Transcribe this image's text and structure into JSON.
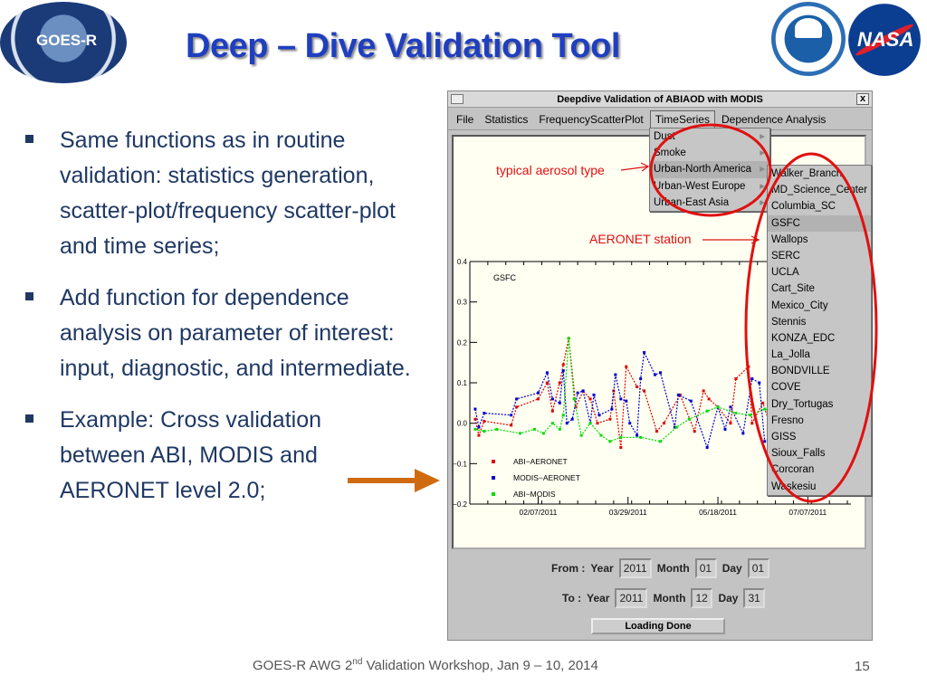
{
  "title": "Deep – Dive Validation Tool",
  "logos": {
    "left": "GOES-R",
    "right1": "NOAA",
    "right2": "NASA"
  },
  "bullets": [
    "Same functions as in routine validation: statistics generation, scatter-plot/frequency scatter-plot and time series;",
    "Add function for dependence analysis on parameter of interest: input, diagnostic, and intermediate.",
    "Example: Cross validation between ABI, MODIS and AERONET level 2.0;"
  ],
  "window": {
    "title": "Deepdive Validation of ABIAOD with MODIS",
    "close": "x",
    "menubar": [
      "File",
      "Statistics",
      "FrequencyScatterPlot",
      "TimeSeries",
      "Dependence Analysis"
    ],
    "open_menu": "TimeSeries",
    "aerosol_menu": [
      "Dust",
      "Smoke",
      "Urban-North America",
      "Urban-West Europe",
      "Urban-East Asia"
    ],
    "aerosol_selected": "Urban-North America",
    "station_menu": [
      "Walker_Branch",
      "MD_Science_Center",
      "Columbia_SC",
      "GSFC",
      "Wallops",
      "SERC",
      "UCLA",
      "Cart_Site",
      "Mexico_City",
      "Stennis",
      "KONZA_EDC",
      "La_Jolla",
      "BONDVILLE",
      "COVE",
      "Dry_Tortugas",
      "Fresno",
      "GISS",
      "Sioux_Falls",
      "Corcoran",
      "Waskesiu"
    ],
    "station_selected": "GSFC",
    "from": {
      "label": "From :",
      "year_label": "Year",
      "year": "2011",
      "month_label": "Month",
      "month": "01",
      "day_label": "Day",
      "day": "01"
    },
    "to": {
      "label": "To :",
      "year_label": "Year",
      "year": "2011",
      "month_label": "Month",
      "month": "12",
      "day_label": "Day",
      "day": "31"
    },
    "button": "Loading Done"
  },
  "annotations": {
    "aerosol": "typical aerosol type",
    "station": "AERONET station",
    "color": "#e01010"
  },
  "footer": {
    "text": "GOES-R AWG 2",
    "sup": "nd",
    "rest": " Validation Workshop, Jan 9 – 10, 2014",
    "page": "15"
  },
  "chart_data": {
    "type": "line",
    "title": "GSFC",
    "ylim": [
      -0.2,
      0.4
    ],
    "yticks": [
      "0.4",
      "0.3",
      "0.2",
      "0.1",
      "0.0",
      "−0.1",
      "−0.2"
    ],
    "xticks": [
      "02/07/2011",
      "03/29/2011",
      "05/18/2011",
      "07/07/2011"
    ],
    "xlim": [
      "2010-12-31",
      "2011-07-31"
    ],
    "legend": "bottom-left",
    "series": [
      {
        "name": "ABI−AERONET",
        "color": "#e00000",
        "points": [
          [
            "2011-01-03",
            0.01
          ],
          [
            "2011-01-05",
            -0.03
          ],
          [
            "2011-01-08",
            0.005
          ],
          [
            "2011-01-23",
            -0.005
          ],
          [
            "2011-01-26",
            0.04
          ],
          [
            "2011-02-07",
            0.06
          ],
          [
            "2011-02-12",
            0.1
          ],
          [
            "2011-02-15",
            0.03
          ],
          [
            "2011-02-19",
            0.1
          ],
          [
            "2011-02-21",
            0.145
          ],
          [
            "2011-02-24",
            0.21
          ],
          [
            "2011-02-28",
            0.04
          ],
          [
            "2011-03-04",
            0.08
          ],
          [
            "2011-03-08",
            0.06
          ],
          [
            "2011-03-12",
            0.0
          ],
          [
            "2011-03-19",
            0.01
          ],
          [
            "2011-03-21",
            0.08
          ],
          [
            "2011-03-25",
            -0.06
          ],
          [
            "2011-03-28",
            0.14
          ],
          [
            "2011-04-03",
            0.09
          ],
          [
            "2011-04-07",
            0.08
          ],
          [
            "2011-04-14",
            -0.02
          ],
          [
            "2011-04-18",
            0.0
          ],
          [
            "2011-04-27",
            0.07
          ],
          [
            "2011-05-05",
            -0.02
          ],
          [
            "2011-05-10",
            0.08
          ],
          [
            "2011-05-13",
            0.06
          ],
          [
            "2011-05-18",
            0.04
          ],
          [
            "2011-05-25",
            0.0
          ],
          [
            "2011-05-28",
            0.11
          ],
          [
            "2011-06-04",
            0.14
          ],
          [
            "2011-06-06",
            0.0
          ],
          [
            "2011-06-12",
            0.05
          ],
          [
            "2011-06-18",
            -0.03
          ],
          [
            "2011-06-22",
            0.05
          ],
          [
            "2011-06-30",
            0.02
          ],
          [
            "2011-07-07",
            0.04
          ],
          [
            "2011-07-15",
            -0.01
          ],
          [
            "2011-07-25",
            0.03
          ]
        ]
      },
      {
        "name": "MODIS−AERONET",
        "color": "#0000d0",
        "points": [
          [
            "2011-01-03",
            0.035
          ],
          [
            "2011-01-05",
            -0.01
          ],
          [
            "2011-01-08",
            0.025
          ],
          [
            "2011-01-23",
            0.02
          ],
          [
            "2011-01-26",
            0.06
          ],
          [
            "2011-02-07",
            0.075
          ],
          [
            "2011-02-12",
            0.125
          ],
          [
            "2011-02-15",
            0.06
          ],
          [
            "2011-02-19",
            0.05
          ],
          [
            "2011-02-21",
            0.13
          ],
          [
            "2011-02-23",
            0.0
          ],
          [
            "2011-02-26",
            0.01
          ],
          [
            "2011-03-01",
            0.075
          ],
          [
            "2011-03-04",
            0.08
          ],
          [
            "2011-03-08",
            0.0
          ],
          [
            "2011-03-10",
            0.07
          ],
          [
            "2011-03-13",
            0.02
          ],
          [
            "2011-03-20",
            0.035
          ],
          [
            "2011-03-22",
            0.12
          ],
          [
            "2011-03-25",
            0.06
          ],
          [
            "2011-03-28",
            0.055
          ],
          [
            "2011-03-30",
            0.0
          ],
          [
            "2011-04-03",
            -0.03
          ],
          [
            "2011-04-05",
            0.11
          ],
          [
            "2011-04-07",
            0.175
          ],
          [
            "2011-04-13",
            0.12
          ],
          [
            "2011-04-16",
            0.125
          ],
          [
            "2011-04-24",
            -0.01
          ],
          [
            "2011-04-26",
            0.07
          ],
          [
            "2011-05-03",
            0.055
          ],
          [
            "2011-05-12",
            -0.06
          ],
          [
            "2011-05-18",
            0.04
          ],
          [
            "2011-05-22",
            -0.015
          ],
          [
            "2011-05-25",
            0.04
          ],
          [
            "2011-06-01",
            -0.025
          ],
          [
            "2011-06-06",
            0.11
          ],
          [
            "2011-06-10",
            0.1
          ],
          [
            "2011-06-13",
            -0.045
          ],
          [
            "2011-06-16",
            -0.035
          ],
          [
            "2011-06-22",
            0.065
          ],
          [
            "2011-06-26",
            -0.025
          ],
          [
            "2011-07-01",
            -0.07
          ],
          [
            "2011-07-07",
            0.05
          ],
          [
            "2011-07-20",
            -0.02
          ],
          [
            "2011-07-28",
            0.02
          ]
        ]
      },
      {
        "name": "ABI−MODIS",
        "color": "#00dd00",
        "points": [
          [
            "2011-01-03",
            -0.015
          ],
          [
            "2011-01-08",
            -0.02
          ],
          [
            "2011-01-15",
            -0.015
          ],
          [
            "2011-01-28",
            -0.025
          ],
          [
            "2011-02-05",
            -0.015
          ],
          [
            "2011-02-10",
            -0.025
          ],
          [
            "2011-02-15",
            -0.0
          ],
          [
            "2011-02-19",
            -0.015
          ],
          [
            "2011-02-21",
            0.02
          ],
          [
            "2011-02-24",
            0.21
          ],
          [
            "2011-02-27",
            0.06
          ],
          [
            "2011-03-03",
            -0.03
          ],
          [
            "2011-03-08",
            0.0
          ],
          [
            "2011-03-14",
            -0.03
          ],
          [
            "2011-03-19",
            -0.045
          ],
          [
            "2011-03-25",
            -0.035
          ],
          [
            "2011-04-05",
            -0.035
          ],
          [
            "2011-04-16",
            -0.045
          ],
          [
            "2011-04-25",
            -0.01
          ],
          [
            "2011-05-02",
            0.01
          ],
          [
            "2011-05-12",
            0.03
          ],
          [
            "2011-05-18",
            0.04
          ],
          [
            "2011-05-28",
            0.025
          ],
          [
            "2011-06-05",
            0.02
          ],
          [
            "2011-06-13",
            0.035
          ],
          [
            "2011-06-22",
            0.025
          ],
          [
            "2011-07-02",
            0.035
          ],
          [
            "2011-07-15",
            0.03
          ],
          [
            "2011-07-28",
            0.02
          ]
        ]
      }
    ]
  }
}
